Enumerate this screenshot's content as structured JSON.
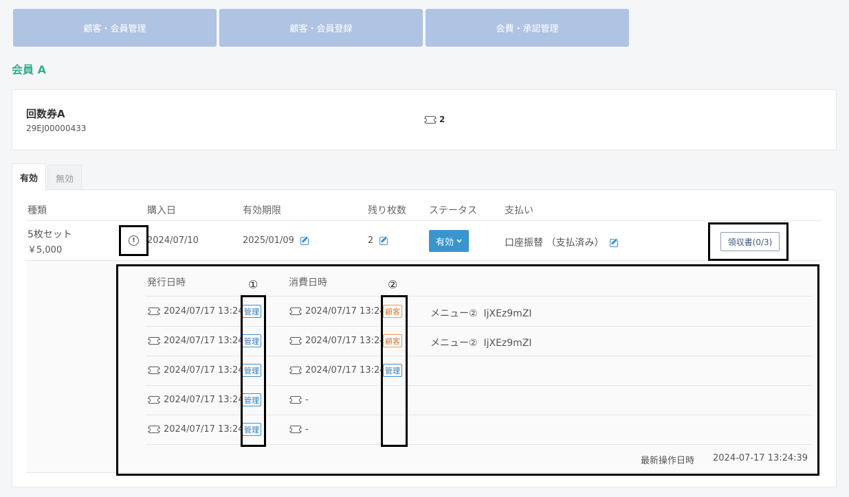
{
  "nav": {
    "tabs": [
      "顧客・会員管理",
      "顧客・会員登録",
      "会費・承認管理"
    ]
  },
  "member_name": "会員 A",
  "ticket": {
    "name": "回数券A",
    "code": "29EJ00000433",
    "count": "2",
    "icon": "ticket-icon"
  },
  "status_tabs": {
    "active": "有効",
    "inactive": "無効"
  },
  "table": {
    "headers": [
      "種類",
      "購入日",
      "有効期限",
      "残り枚数",
      "ステータス",
      "支払い"
    ],
    "row": {
      "type_name": "5枚セット",
      "price": "￥5,000",
      "purchase_date": "2024/07/10",
      "expiry_date": "2025/01/09",
      "remaining": "2",
      "status_label": "有効",
      "payment": "口座振替 （支払済み）",
      "receipt_label": "領収書(0/3)",
      "info_icon": "!"
    }
  },
  "history": {
    "headers": {
      "issued": "発行日時",
      "consumed": "消費日時"
    },
    "markers": {
      "one": "①",
      "two": "②"
    },
    "rows": [
      {
        "issued": "2024/07/17 13:24",
        "issued_badge": "管理",
        "consumed": "2024/07/17 13:24",
        "consumed_badge": "顧客",
        "menu": "メニュー②",
        "menu_code": "IjXEz9mZI"
      },
      {
        "issued": "2024/07/17 13:24",
        "issued_badge": "管理",
        "consumed": "2024/07/17 13:24",
        "consumed_badge": "顧客",
        "menu": "メニュー②",
        "menu_code": "IjXEz9mZI"
      },
      {
        "issued": "2024/07/17 13:24",
        "issued_badge": "管理",
        "consumed": "2024/07/17 13:24",
        "consumed_badge": "管理",
        "menu": "",
        "menu_code": ""
      },
      {
        "issued": "2024/07/17 13:24",
        "issued_badge": "管理",
        "consumed": "-",
        "consumed_badge": "",
        "menu": "",
        "menu_code": ""
      },
      {
        "issued": "2024/07/17 13:24",
        "issued_badge": "管理",
        "consumed": "-",
        "consumed_badge": "",
        "menu": "",
        "menu_code": ""
      }
    ],
    "last_op_label": "最新操作日時",
    "last_op_value": "2024-07-17 13:24:39"
  }
}
